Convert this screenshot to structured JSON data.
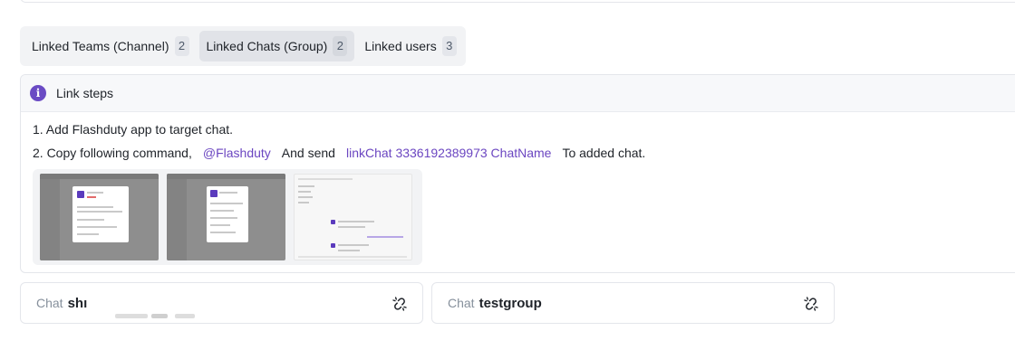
{
  "tabs": [
    {
      "label": "Linked Teams (Channel)",
      "count": "2",
      "active": false
    },
    {
      "label": "Linked Chats (Group)",
      "count": "2",
      "active": true
    },
    {
      "label": "Linked users",
      "count": "3",
      "active": false
    }
  ],
  "steps": {
    "title": "Link steps",
    "icon": "info-icon",
    "step1": "1. Add Flashduty app to target chat.",
    "step2_prefix": "2. Copy following command,",
    "mention": "@Flashduty",
    "and_send": "And send",
    "command": "linkChat 3336192389973 ChatName",
    "to_added": "To added chat."
  },
  "chats": [
    {
      "prefix": "Chat",
      "name": "shı",
      "icon": "unlink-icon"
    },
    {
      "prefix": "Chat",
      "name": "testgroup",
      "icon": "unlink-icon"
    }
  ],
  "colors": {
    "accent": "#6b46c1",
    "info": "#6a4bc4"
  }
}
